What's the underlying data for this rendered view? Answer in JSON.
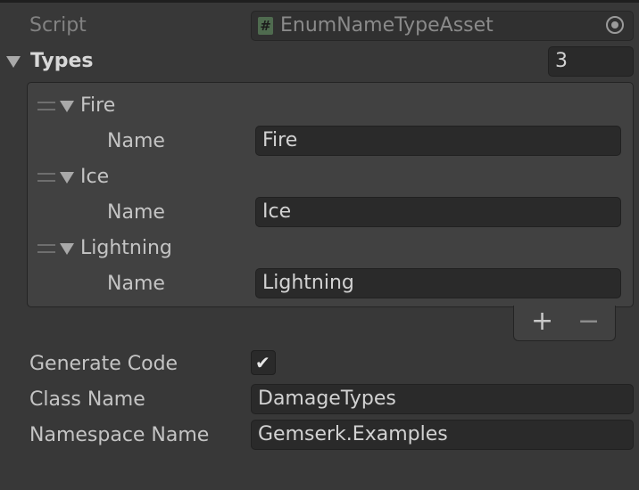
{
  "script_row": {
    "label": "Script",
    "value": "EnumNameTypeAsset",
    "icon": "csharp-script-icon"
  },
  "types": {
    "label": "Types",
    "size": "3",
    "elements": [
      {
        "header": "Fire",
        "field_label": "Name",
        "field_value": "Fire"
      },
      {
        "header": "Ice",
        "field_label": "Name",
        "field_value": "Ice"
      },
      {
        "header": "Lightning",
        "field_label": "Name",
        "field_value": "Lightning"
      }
    ],
    "add_symbol": "+",
    "remove_symbol": "−"
  },
  "generate_code": {
    "label": "Generate Code",
    "checked": true,
    "check_glyph": "✔"
  },
  "class_name": {
    "label": "Class Name",
    "value": "DamageTypes"
  },
  "namespace_name": {
    "label": "Namespace Name",
    "value": "Gemserk.Examples"
  },
  "colors": {
    "background": "#383838",
    "field": "#2a2a2a",
    "list": "#414141",
    "text": "#c4c4c4"
  }
}
